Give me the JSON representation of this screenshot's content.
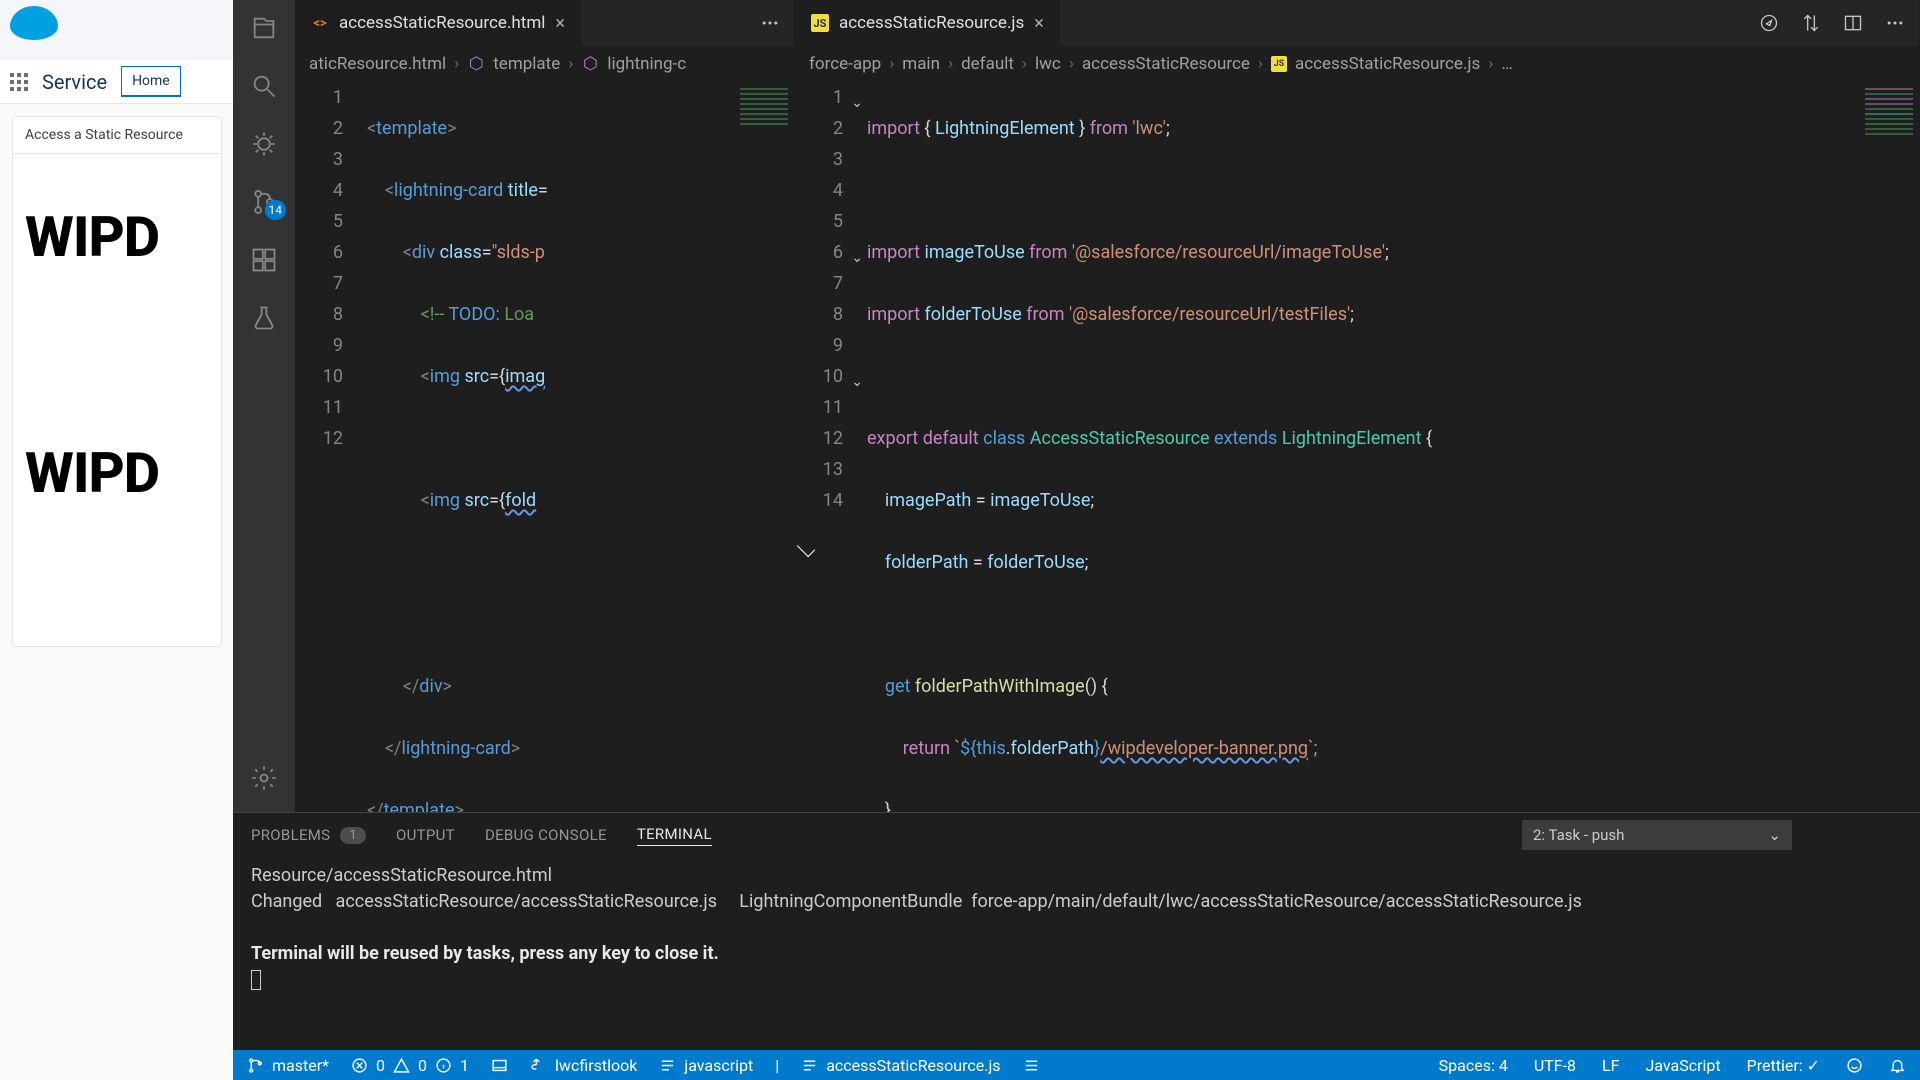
{
  "salesforce": {
    "service_label": "Service",
    "home_tab": "Home",
    "card_title": "Access a Static Resource",
    "wip1": "WIPD",
    "wip2": "WIPD"
  },
  "activitybar": {
    "scm_badge": "14"
  },
  "left_editor": {
    "tab_label": "accessStaticResource.html",
    "breadcrumb": [
      "aticResource.html",
      "template",
      "lightning-c"
    ],
    "lines": [
      "1",
      "2",
      "3",
      "4",
      "5",
      "6",
      "7",
      "8",
      "9",
      "10",
      "11",
      "12"
    ]
  },
  "right_editor": {
    "tab_label": "accessStaticResource.js",
    "breadcrumb": [
      "force-app",
      "main",
      "default",
      "lwc",
      "accessStaticResource",
      "accessStaticResource.js",
      "…"
    ],
    "lines": [
      "1",
      "2",
      "3",
      "4",
      "5",
      "6",
      "7",
      "8",
      "9",
      "10",
      "11",
      "12",
      "13",
      "14"
    ]
  },
  "code_html": {
    "l1_a": "<",
    "l1_b": "template",
    "l1_c": ">",
    "l2_a": "<",
    "l2_b": "lightning-card",
    "l2_c": " ",
    "l2_d": "title",
    "l2_e": "=",
    "l3_a": "<",
    "l3_b": "div",
    "l3_c": " ",
    "l3_d": "class",
    "l3_e": "=",
    "l3_f": "\"slds-p",
    "l4_a": "<!-- ",
    "l4_b": "TODO:",
    "l4_c": " Loa",
    "l5_a": "<",
    "l5_b": "img",
    "l5_c": " ",
    "l5_d": "src",
    "l5_e": "=",
    "l5_f": "{",
    "l5_g": "imag",
    "l7_a": "<",
    "l7_b": "img",
    "l7_c": " ",
    "l7_d": "src",
    "l7_e": "=",
    "l7_f": "{",
    "l7_g": "fold",
    "l10_a": "</",
    "l10_b": "div",
    "l10_c": ">",
    "l11_a": "</",
    "l11_b": "lightning-card",
    "l11_c": ">",
    "l12_a": "</",
    "l12_b": "template",
    "l12_c": ">"
  },
  "code_js": {
    "l1_a": "import",
    "l1_b": " { ",
    "l1_c": "LightningElement",
    "l1_d": " } ",
    "l1_e": "from",
    "l1_f": " ",
    "l1_g": "'lwc'",
    "l1_h": ";",
    "l3_a": "import",
    "l3_b": " ",
    "l3_c": "imageToUse",
    "l3_d": " ",
    "l3_e": "from",
    "l3_f": " ",
    "l3_g": "'@salesforce/resourceUrl/imageToUse'",
    "l3_h": ";",
    "l4_a": "import",
    "l4_b": " ",
    "l4_c": "folderToUse",
    "l4_d": " ",
    "l4_e": "from",
    "l4_f": " ",
    "l4_g": "'@salesforce/resourceUrl/testFiles'",
    "l4_h": ";",
    "l6_a": "export",
    "l6_b": " ",
    "l6_c": "default",
    "l6_d": " ",
    "l6_e": "class",
    "l6_f": " ",
    "l6_g": "AccessStaticResource",
    "l6_h": " ",
    "l6_i": "extends",
    "l6_j": " ",
    "l6_k": "LightningElement",
    "l6_l": " {",
    "l7_a": "    ",
    "l7_b": "imagePath",
    "l7_c": " = ",
    "l7_d": "imageToUse",
    "l7_e": ";",
    "l8_a": "    ",
    "l8_b": "folderPath",
    "l8_c": " = ",
    "l8_d": "folderToUse",
    "l8_e": ";",
    "l10_a": "    ",
    "l10_b": "get",
    "l10_c": " ",
    "l10_d": "folderPathWithImage",
    "l10_e": "() {",
    "l11_a": "        ",
    "l11_b": "return",
    "l11_c": " `",
    "l11_d": "${",
    "l11_e": "this",
    "l11_f": ".",
    "l11_g": "folderPath",
    "l11_h": "}",
    "l11_i": "/wipdeveloper-banner.png",
    "l11_j": "`;",
    "l12_a": "    }",
    "l13_a": "}"
  },
  "panel": {
    "tabs": {
      "problems": "PROBLEMS",
      "problems_n": "1",
      "output": "OUTPUT",
      "debug": "DEBUG CONSOLE",
      "terminal": "TERMINAL"
    },
    "task_select": "2: Task - push",
    "term_line1": "Resource/accessStaticResource.html",
    "term_line2": "Changed   accessStaticResource/accessStaticResource.js     LightningComponentBundle  force-app/main/default/lwc/accessStaticResource/accessStaticResource.js",
    "term_line3": "Terminal will be reused by tasks, press any key to close it."
  },
  "status": {
    "branch": "master*",
    "err": "0",
    "warn": "0",
    "info": "1",
    "org": "lwcfirstlook",
    "lang": "javascript",
    "file": "accessStaticResource.js",
    "spaces": "Spaces: 4",
    "enc": "UTF-8",
    "eol": "LF",
    "mode": "JavaScript",
    "prettier": "Prettier: ✓"
  }
}
